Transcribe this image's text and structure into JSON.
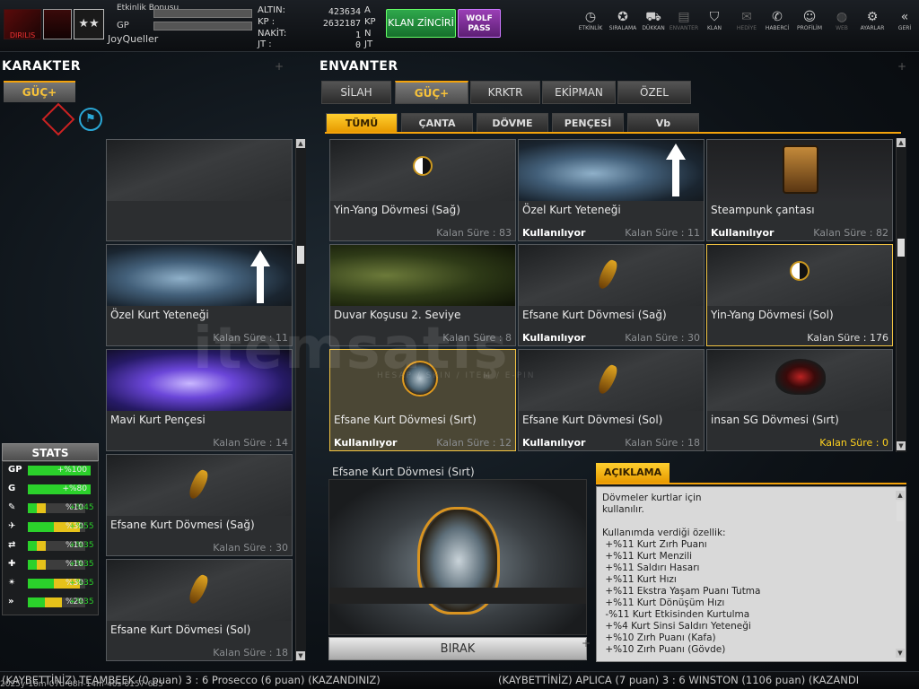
{
  "topbar": {
    "nickname": "JoyQueller",
    "bonus_label": "Etkinlik Bonusu",
    "gp_label": "GP",
    "currencies": [
      {
        "label": "ALTIN:",
        "value": "423634",
        "unit": "A"
      },
      {
        "label": "KP :",
        "value": "2632187",
        "unit": "KP"
      },
      {
        "label": "NAKİT:",
        "value": "1",
        "unit": "N"
      },
      {
        "label": "JT :",
        "value": "0",
        "unit": "JT"
      }
    ],
    "klan_button": "KLAN ZİNCİRİ",
    "wolf_button": "WOLF PASS",
    "nav": [
      {
        "label": "ETKİNLİK",
        "icon": "clock-icon",
        "glyph": "◷"
      },
      {
        "label": "SIRALAMA",
        "icon": "medal-icon",
        "glyph": "✪"
      },
      {
        "label": "DÜKKAN",
        "icon": "cart-icon",
        "glyph": "⛟"
      },
      {
        "label": "ENVANTER",
        "icon": "inventory-icon",
        "glyph": "▤"
      },
      {
        "label": "KLAN",
        "icon": "shield-icon",
        "glyph": "⛉"
      },
      {
        "label": "HEDİYE",
        "icon": "gift-icon",
        "glyph": "✉"
      },
      {
        "label": "HABERCİ",
        "icon": "megaphone-icon",
        "glyph": "✆"
      },
      {
        "label": "PROFİLİM",
        "icon": "profile-icon",
        "glyph": "☺"
      },
      {
        "label": "WEB",
        "icon": "globe-icon",
        "glyph": "◍"
      },
      {
        "label": "AYARLAR",
        "icon": "gear-icon",
        "glyph": "⚙"
      },
      {
        "label": "GERİ",
        "icon": "back-icon",
        "glyph": "«"
      }
    ]
  },
  "karakter": {
    "title": "KARAKTER",
    "tab": "GÜÇ+",
    "slots": [
      {
        "name": "",
        "time": ""
      },
      {
        "name": "Özel Kurt Yeteneği",
        "time": "Kalan Süre : 11"
      },
      {
        "name": "Mavi Kurt Pençesi",
        "time": "Kalan Süre : 14"
      },
      {
        "name": "Efsane Kurt Dövmesi (Sağ)",
        "time": "Kalan Süre : 30"
      },
      {
        "name": "Efsane Kurt Dövmesi (Sol)",
        "time": "Kalan Süre : 18"
      }
    ]
  },
  "stats": {
    "title": "STATS",
    "rows": [
      {
        "icon": "GP",
        "value": "+%100",
        "fill": 1.0,
        "extra": ""
      },
      {
        "icon": "G",
        "value": "+%80",
        "fill": 1.0,
        "extra": ""
      },
      {
        "icon": "✎",
        "value": "%10",
        "fill": 0.15,
        "extra": "+%45"
      },
      {
        "icon": "✈",
        "value": "%30",
        "fill": 0.45,
        "extra": "+%55"
      },
      {
        "icon": "⇄",
        "value": "%10",
        "fill": 0.15,
        "extra": "+%35"
      },
      {
        "icon": "✚",
        "value": "%10",
        "fill": 0.15,
        "extra": "+%35"
      },
      {
        "icon": "✴",
        "value": "%30",
        "fill": 0.45,
        "extra": "+%35"
      },
      {
        "icon": "»",
        "value": "%20",
        "fill": 0.3,
        "extra": "+%35"
      }
    ]
  },
  "envanter": {
    "title": "ENVANTER",
    "tabs": [
      "SİLAH",
      "GÜÇ+",
      "KRKTR",
      "EKİPMAN",
      "ÖZEL"
    ],
    "subtabs": [
      "TÜMÜ",
      "ÇANTA",
      "DÖVME",
      "PENÇESİ",
      "Vb"
    ],
    "items": [
      {
        "name": "Yin-Yang Dövmesi (Sağ)",
        "state": "",
        "time": "Kalan Süre : 83"
      },
      {
        "name": "Özel Kurt Yeteneği",
        "state": "Kullanılıyor",
        "time": "Kalan Süre : 11"
      },
      {
        "name": "Steampunk çantası",
        "state": "Kullanılıyor",
        "time": "Kalan Süre : 82"
      },
      {
        "name": "Duvar Koşusu 2. Seviye",
        "state": "",
        "time": "Kalan Süre : 8"
      },
      {
        "name": "Efsane Kurt Dövmesi (Sağ)",
        "state": "Kullanılıyor",
        "time": "Kalan Süre : 30"
      },
      {
        "name": "Yin-Yang Dövmesi (Sol)",
        "state": "",
        "time": "Kalan Süre : 176"
      },
      {
        "name": "Efsane Kurt Dövmesi (Sırt)",
        "state": "Kullanılıyor",
        "time": "Kalan Süre : 12"
      },
      {
        "name": "Efsane Kurt Dövmesi (Sol)",
        "state": "Kullanılıyor",
        "time": "Kalan Süre : 18"
      },
      {
        "name": "insan SG Dövmesi (Sırt)",
        "state": "",
        "time": "Kalan Süre : 0"
      }
    ]
  },
  "detail": {
    "title": "Efsane Kurt Dövmesi (Sırt)",
    "drop_button": "BIRAK",
    "description_tab": "AÇIKLAMA",
    "description": "Dövmeler kurtlar için\nkullanılır.\n\nKullanımda verdiği özellik:\n +%11 Kurt Zırh Puanı\n +%11 Kurt Menzili\n +%11 Saldırı Hasarı\n +%11 Kurt Hızı\n +%11 Ekstra Yaşam Puanı Tutma\n +%11 Kurt Dönüşüm Hızı\n -%11 Kurt Etkisinden Kurtulma\n +%4 Kurt Sinsi Saldırı Yeteneği\n +%10 Zırh Puanı (Kafa)\n +%10 Zırh Puanı (Gövde)"
  },
  "ticker": {
    "left": "(KAYBETTİNİZ) TEAMBEEK (0 puan) 3 : 6 Prosecco (6 puan) (KAZANDINIZ)",
    "right": "(KAYBETTİNİZ) APLICA (7 puan) 3 : 6 WINSTON (1106 puan) (KAZANDI",
    "time": "2025y-10m-07d-08h-14m-46s-0157-685"
  },
  "watermark": "itemsatış",
  "watermark_sub": "HESAP / SKIN / ITEM / E-PIN",
  "colors": {
    "accent": "#f3a20b",
    "used": "#ffffff",
    "klan": "#2fa84c",
    "wolf": "#9a3fb5"
  }
}
